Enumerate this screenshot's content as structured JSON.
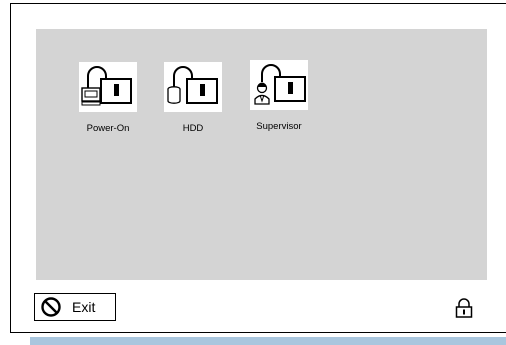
{
  "items": [
    {
      "label": "Power-On",
      "icon": "power-on-lock-icon"
    },
    {
      "label": "HDD",
      "icon": "hdd-lock-icon"
    },
    {
      "label": "Supervisor",
      "icon": "supervisor-lock-icon"
    }
  ],
  "exit_button": {
    "label": "Exit",
    "icon": "no-entry-icon"
  },
  "lock_button": {
    "icon": "padlock-icon"
  },
  "colors": {
    "panel": "#d4d4d4",
    "bottom_strip": "#a9c6de"
  }
}
